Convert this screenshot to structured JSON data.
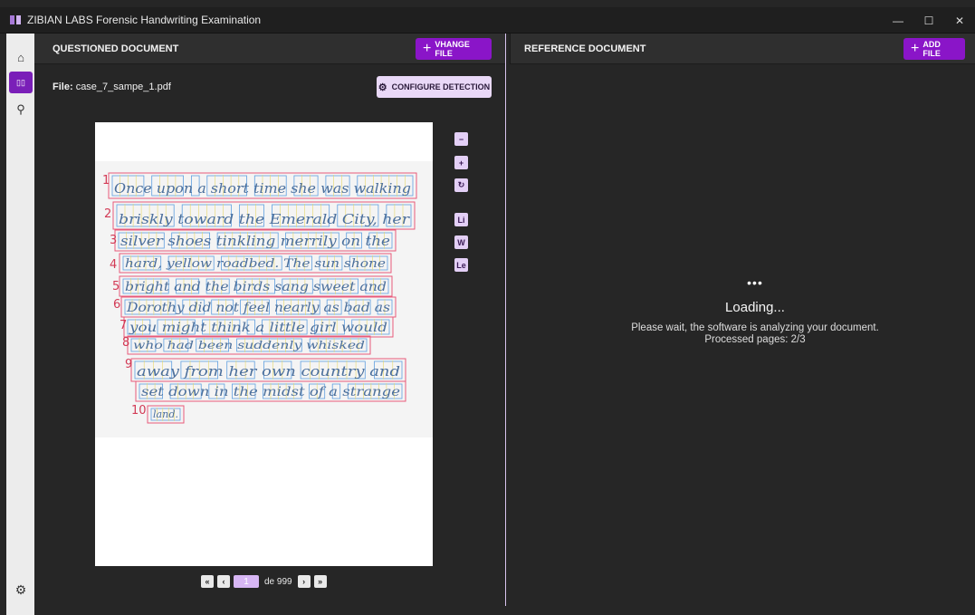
{
  "app": {
    "title": "ZIBIAN LABS Forensic Handwriting Examination"
  },
  "window_controls": {
    "minimize": "—",
    "maximize": "☐",
    "close": "✕"
  },
  "rail": {
    "items": [
      {
        "name": "home",
        "icon": "home-icon",
        "glyph": "⌂"
      },
      {
        "name": "compare",
        "icon": "columns-icon",
        "glyph": "▯▯"
      },
      {
        "name": "search",
        "icon": "search-icon",
        "glyph": "⚲"
      }
    ],
    "settings_glyph": "⚙"
  },
  "questioned": {
    "title": "QUESTIONED DOCUMENT",
    "change_button": "VHANGE FILE",
    "file_label": "File:",
    "file_name": "case_7_sampe_1.pdf",
    "configure_button": "CONFIGURE DETECTION",
    "line_numbers": [
      "1",
      "2",
      "3",
      "4",
      "5",
      "6",
      "7",
      "8",
      "9",
      "10"
    ],
    "handwriting_lines": [
      "Once upon a short time she was walking",
      "briskly toward the Emerald City, her",
      "silver shoes tinkling merrily on the",
      "hard, yellow roadbed. The sun shone",
      "bright and the birds sang sweet and",
      "Dorothy did not feel nearly as bad as",
      "you might think a little girl would",
      "who had been suddenly whisked",
      "away from her own country and",
      "set down in the midst of a strange",
      "land."
    ],
    "tools": {
      "zoom_out": "−",
      "zoom_in": "+",
      "rotate": "↻",
      "lines": "Li",
      "words": "W",
      "letters": "Le"
    },
    "pager": {
      "first": "«",
      "prev": "‹",
      "current": "1",
      "of_text": "de 999",
      "next": "›",
      "last": "»"
    }
  },
  "reference": {
    "title": "REFERENCE DOCUMENT",
    "add_button": "ADD FILE",
    "loading_dots": "•••",
    "loading_title": "Loading...",
    "loading_message": "Please wait, the software is analyzing your document.",
    "processed_text": "Processed pages: 2/3"
  },
  "colors": {
    "accent": "#8a15c8",
    "light_accent": "#e9d8f7",
    "box_red": "#e85a7a",
    "box_blue": "#5f9fe0",
    "box_yellow": "#e8d86a"
  }
}
